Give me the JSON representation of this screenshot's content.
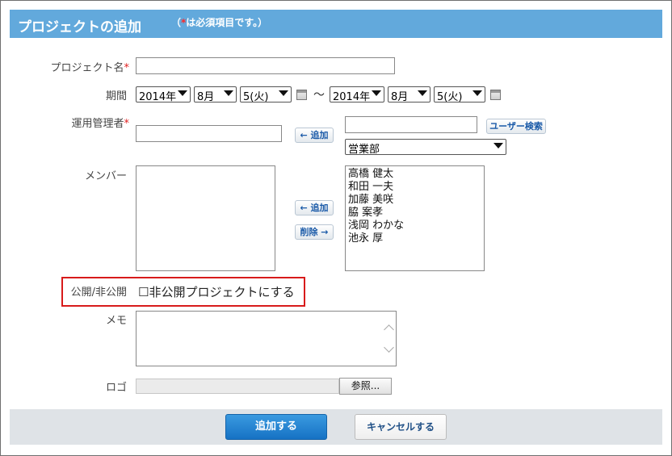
{
  "header": {
    "title": "プロジェクトの追加",
    "note_open": "（",
    "note_star": "*",
    "note_text": "は必須項目です。）"
  },
  "labels": {
    "project_name": "プロジェクト名",
    "period": "期間",
    "admin": "運用管理者",
    "members": "メンバー",
    "visibility": "公開/非公開",
    "memo": "メモ",
    "logo": "ロゴ",
    "required_star": "*"
  },
  "period": {
    "start_year": "2014年",
    "start_month": "8月",
    "start_day": "5(火)",
    "separator": "～",
    "end_year": "2014年",
    "end_month": "8月",
    "end_day": "5(火)"
  },
  "admin": {
    "add_button": "← 追加",
    "user_search_button": "ユーザー検索",
    "department": "営業部"
  },
  "members": {
    "add_button": "← 追加",
    "remove_button": "削除 →",
    "candidates": [
      "高橋 健太",
      "和田 一夫",
      "加藤 美咲",
      "脇 案孝",
      "浅岡 わかな",
      "池永 厚"
    ]
  },
  "visibility": {
    "checkbox_text": "☐非公開プロジェクトにする"
  },
  "logo": {
    "browse_button": "参照..."
  },
  "footer": {
    "submit_button": "追加する",
    "cancel_button": "キャンセルする"
  }
}
